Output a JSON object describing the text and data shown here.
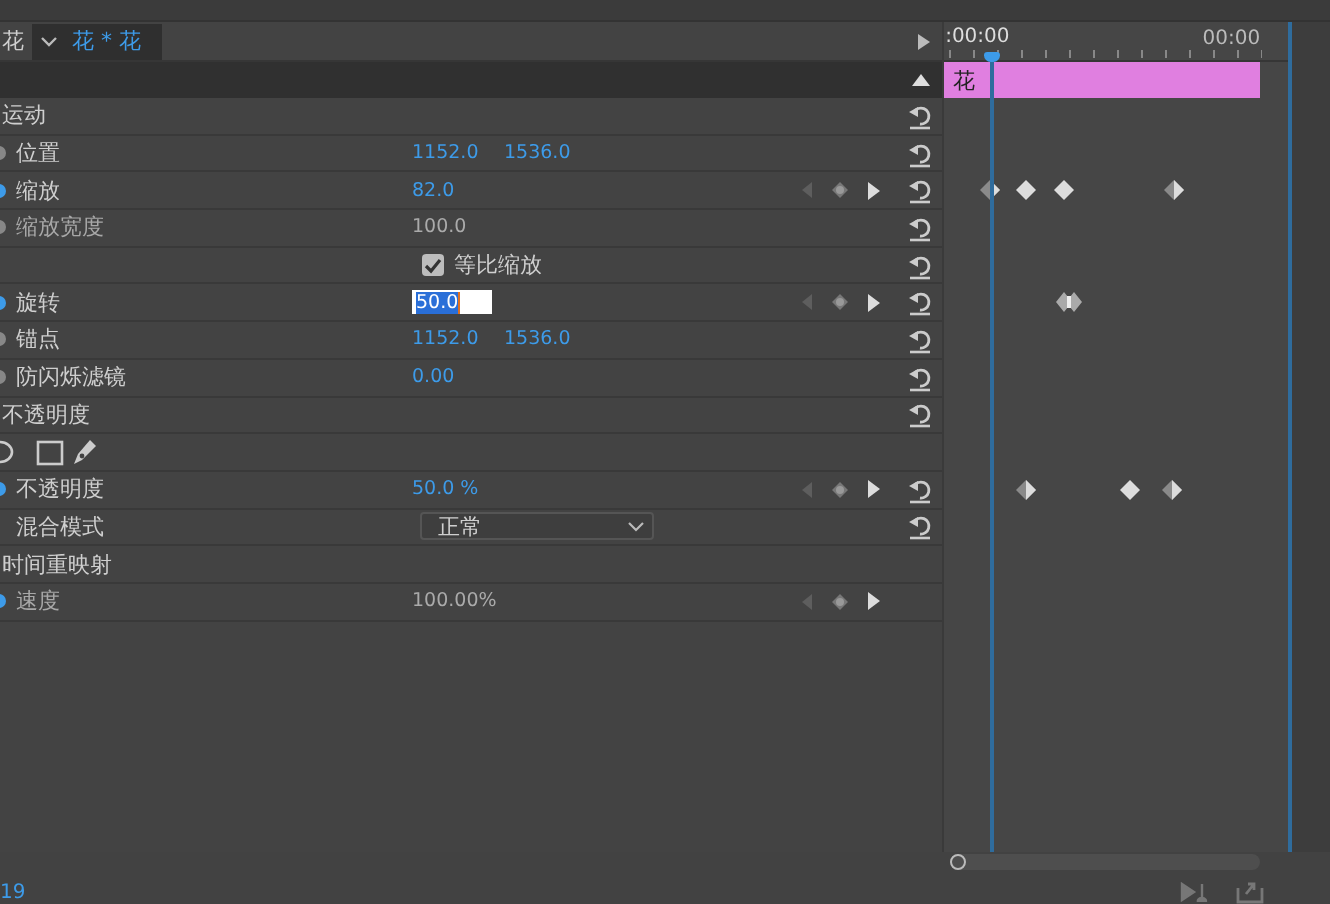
{
  "header": {
    "clip_name": "花",
    "sequence": "花 * 花",
    "ruler_start": ":00:00",
    "ruler_end": "00:00"
  },
  "clip_bar": {
    "label": "花"
  },
  "rows": [
    {
      "kind": "section",
      "label": "运动",
      "has_reset": true
    },
    {
      "kind": "property",
      "label": "位置",
      "animated": false,
      "disabled": false,
      "values": [
        "1152.0",
        "1536.0"
      ],
      "has_reset": true
    },
    {
      "kind": "property",
      "label": "缩放",
      "animated": true,
      "disabled": false,
      "values": [
        "82.0"
      ],
      "has_reset": true,
      "keyframes": [
        {
          "kind": "half"
        },
        {
          "kind": "full"
        },
        {
          "kind": "full"
        },
        {
          "kind": "half"
        }
      ]
    },
    {
      "kind": "property",
      "label": "缩放宽度",
      "animated": false,
      "disabled": true,
      "values": [
        "100.0"
      ],
      "has_reset": true
    },
    {
      "kind": "checkbox",
      "label": "等比缩放",
      "checked": true,
      "has_reset": true
    },
    {
      "kind": "property",
      "label": "旋转",
      "animated": true,
      "disabled": false,
      "editing": true,
      "values": [
        "50.0"
      ],
      "has_reset": true,
      "keyframes": [
        {
          "kind": "pair"
        }
      ]
    },
    {
      "kind": "property",
      "label": "锚点",
      "animated": false,
      "disabled": false,
      "values": [
        "1152.0",
        "1536.0"
      ],
      "has_reset": true
    },
    {
      "kind": "property",
      "label": "防闪烁滤镜",
      "animated": false,
      "disabled": false,
      "values": [
        "0.00"
      ],
      "has_reset": true
    },
    {
      "kind": "section",
      "label": "不透明度",
      "has_reset": true
    },
    {
      "kind": "masks",
      "has_reset": false
    },
    {
      "kind": "property",
      "label": "不透明度",
      "animated": true,
      "disabled": false,
      "values": [
        "50.0 %"
      ],
      "has_reset": true,
      "keyframes": [
        {
          "kind": "half"
        },
        {
          "kind": "full"
        },
        {
          "kind": "half"
        }
      ]
    },
    {
      "kind": "dropdown",
      "label": "混合模式",
      "value": "正常",
      "has_reset": true
    },
    {
      "kind": "section",
      "label": "时间重映射",
      "has_reset": false
    },
    {
      "kind": "property",
      "label": "速度",
      "animated": true,
      "disabled": true,
      "values": [
        "100.00%"
      ],
      "has_reset": false
    }
  ],
  "status_bar": {
    "timecode": "19"
  }
}
